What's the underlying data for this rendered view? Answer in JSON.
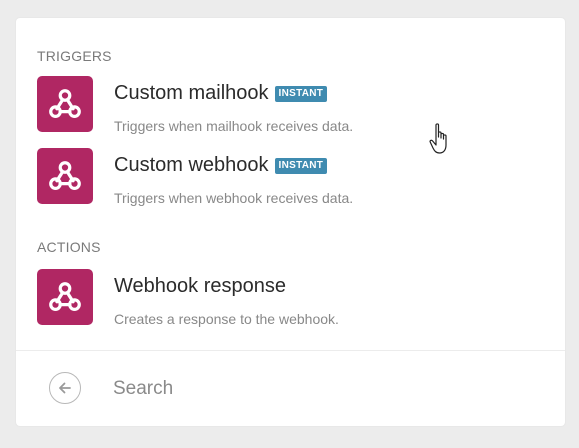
{
  "colors": {
    "brand": "#b02763",
    "badge": "#3f8bb0"
  },
  "triggers": {
    "title": "TRIGGERS",
    "items": [
      {
        "title": "Custom mailhook",
        "badge": "INSTANT",
        "description": "Triggers when mailhook receives data.",
        "icon": "webhook-icon"
      },
      {
        "title": "Custom webhook",
        "badge": "INSTANT",
        "description": "Triggers when webhook receives data.",
        "icon": "webhook-icon"
      }
    ]
  },
  "actions": {
    "title": "ACTIONS",
    "items": [
      {
        "title": "Webhook response",
        "description": "Creates a response to the webhook.",
        "icon": "webhook-icon"
      }
    ]
  },
  "search": {
    "placeholder": "Search",
    "back_icon": "arrow-left-circle-icon"
  }
}
